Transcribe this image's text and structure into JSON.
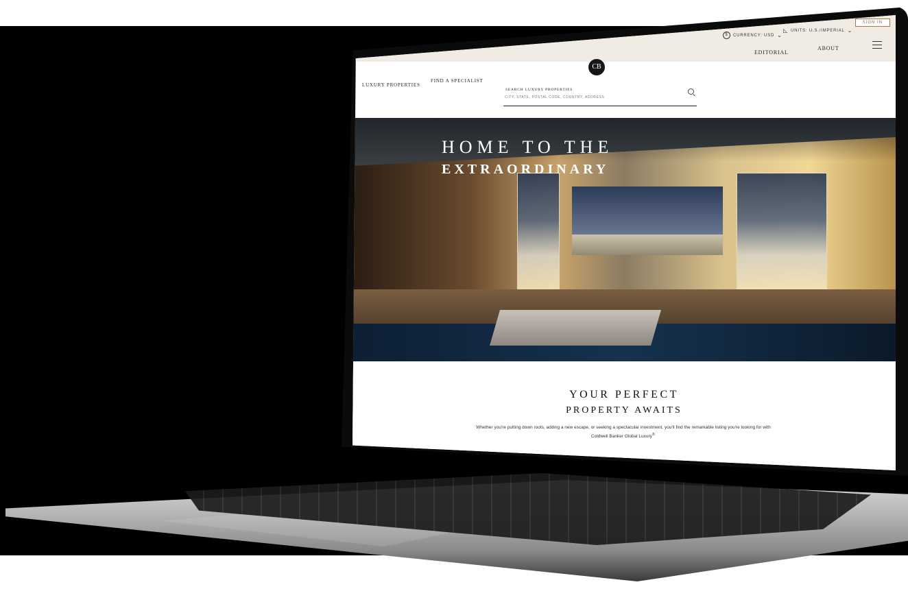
{
  "utility_bar": {
    "currency_label": "CURRENCY: USD",
    "units_label": "UNITS: U.S./IMPERIAL",
    "sign_in_label": "SIGN IN"
  },
  "top_nav": {
    "editorial_label": "EDITORIAL",
    "about_label": "ABOUT"
  },
  "main_nav": {
    "luxury_properties_label": "LUXURY PROPERTIES",
    "find_specialist_label": "FIND A SPECIALIST"
  },
  "logo": {
    "text": "CB"
  },
  "search": {
    "label": "SEARCH LUXURY PROPERTIES",
    "placeholder": "CITY, STATE, POSTAL CODE, COUNTRY, ADDRESS",
    "value": ""
  },
  "hero": {
    "line1": "HOME TO THE",
    "line2": "EXTRAORDINARY"
  },
  "content": {
    "title_line1": "YOUR PERFECT",
    "title_line2": "PROPERTY AWAITS",
    "paragraph": "Whether you're putting down roots, adding a new escape, or seeking a spectacular investment, you'll find the remarkable listing you're looking for with Coldwell Banker Global Luxury",
    "registered_mark": "®."
  },
  "icons": {
    "currency": "currency-icon",
    "units": "ruler-icon",
    "menu": "hamburger-icon",
    "search": "search-icon"
  }
}
